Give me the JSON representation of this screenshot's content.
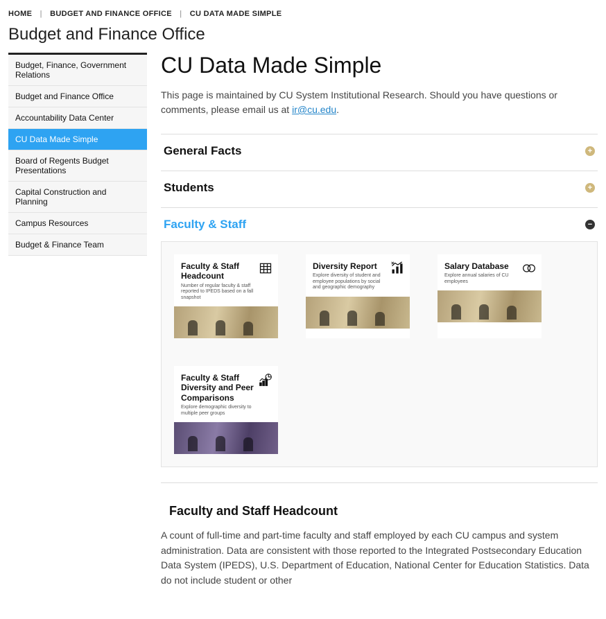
{
  "breadcrumbs": {
    "home": "HOME",
    "mid": "BUDGET AND FINANCE OFFICE",
    "current": "CU DATA MADE SIMPLE"
  },
  "page_title": "Budget and Finance Office",
  "sidebar": {
    "items": [
      {
        "label": "Budget, Finance, Government Relations",
        "active": false
      },
      {
        "label": "Budget and Finance Office",
        "active": false
      },
      {
        "label": "Accountability Data Center",
        "active": false
      },
      {
        "label": "CU Data Made Simple",
        "active": true
      },
      {
        "label": "Board of Regents Budget Presentations",
        "active": false
      },
      {
        "label": "Capital Construction and Planning",
        "active": false
      },
      {
        "label": "Campus Resources",
        "active": false
      },
      {
        "label": "Budget & Finance Team",
        "active": false
      }
    ]
  },
  "main": {
    "heading": "CU Data Made Simple",
    "intro_prefix": "This page is maintained by CU System Institutional Research. Should you have questions or comments, please email us at ",
    "intro_link_text": "ir@cu.edu",
    "intro_suffix": ".",
    "accordions": [
      {
        "title": "General Facts",
        "open": false
      },
      {
        "title": "Students",
        "open": false
      },
      {
        "title": "Faculty & Staff",
        "open": true
      }
    ],
    "cards": [
      {
        "title": "Faculty & Staff Headcount",
        "desc": "Number of regular faculty & staff reported to IPEDS based on a fall snapshot",
        "icon": "table-icon",
        "tint": "sepia"
      },
      {
        "title": "Diversity Report",
        "desc": "Explore diversity of student and employee populations by social and geographic demography",
        "icon": "bar-chart-icon",
        "tint": "sepia"
      },
      {
        "title": "Salary Database",
        "desc": "Explore annual salaries of CU employees",
        "icon": "coins-icon",
        "tint": "sepia"
      },
      {
        "title": "Faculty & Staff Diversity and Peer Comparisons",
        "desc": "Explore demographic diversity to multiple peer groups",
        "icon": "pie-bar-icon",
        "tint": "purple"
      }
    ],
    "subsection_title": "Faculty and Staff Headcount",
    "subsection_body": "A count of full-time and part-time faculty and staff employed by each CU campus and system administration.  Data are consistent with those reported to the Integrated Postsecondary Education Data System (IPEDS), U.S. Department of Education, National Center for Education Statistics.  Data do not include student or other"
  }
}
